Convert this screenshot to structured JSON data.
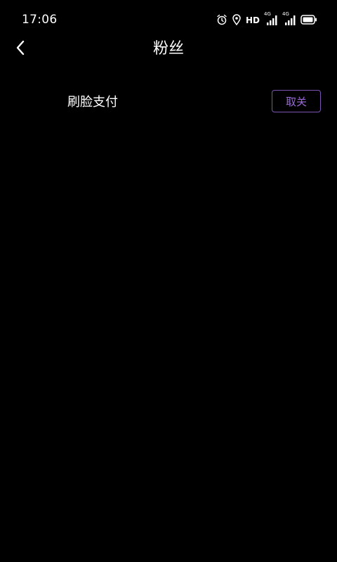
{
  "status_bar": {
    "time": "17:06",
    "hd_label": "HD",
    "network_1": "4G",
    "network_2": "4G",
    "icons": [
      "alarm-icon",
      "location-icon",
      "signal-icon",
      "signal-icon",
      "battery-icon"
    ]
  },
  "header": {
    "back_icon": "chevron-left-icon",
    "title": "粉丝"
  },
  "setting_row": {
    "label": "刷脸支付",
    "button_label": "取关"
  },
  "colors": {
    "background": "#000000",
    "text": "#ffffff",
    "accent_border": "#7b54b3",
    "accent_text": "#9a6ad6"
  }
}
